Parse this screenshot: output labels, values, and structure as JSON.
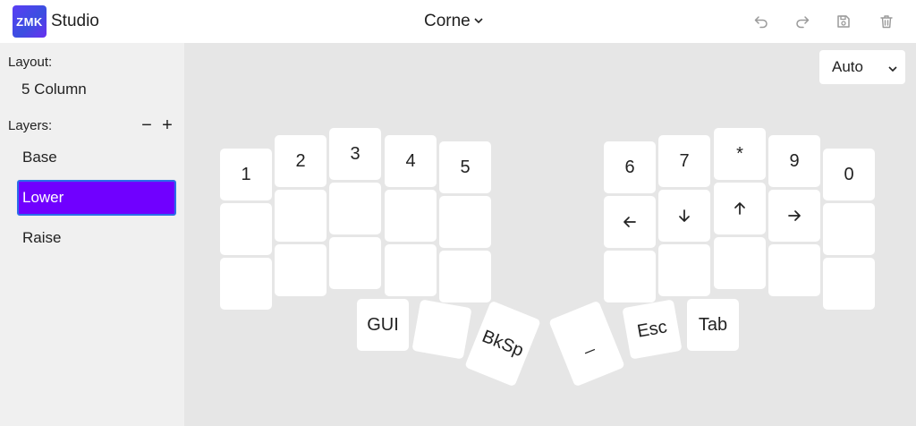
{
  "header": {
    "logo_text": "ZMK",
    "app_name": "Studio",
    "keyboard_name": "Corne"
  },
  "sidebar": {
    "layout_label": "Layout:",
    "layout_name": "5 Column",
    "layers_label": "Layers:",
    "remove_layer_label": "−",
    "add_layer_label": "+",
    "layers": [
      {
        "label": "Base"
      },
      {
        "label": "Lower",
        "selected": true
      },
      {
        "label": "Raise"
      }
    ]
  },
  "canvas": {
    "zoom_value": "Auto"
  },
  "keys": [
    {
      "label": "1"
    },
    {
      "label": "2"
    },
    {
      "label": "3"
    },
    {
      "label": "4"
    },
    {
      "label": "5"
    },
    {
      "label": "6"
    },
    {
      "label": "7"
    },
    {
      "label": "*"
    },
    {
      "label": "9"
    },
    {
      "label": "0"
    },
    {
      "label": ""
    },
    {
      "label": ""
    },
    {
      "label": ""
    },
    {
      "label": ""
    },
    {
      "label": ""
    },
    {
      "icon": "arrow-left-icon"
    },
    {
      "icon": "arrow-down-icon"
    },
    {
      "icon": "arrow-up-icon"
    },
    {
      "icon": "arrow-right-icon"
    },
    {
      "label": ""
    },
    {
      "label": ""
    },
    {
      "label": ""
    },
    {
      "label": ""
    },
    {
      "label": ""
    },
    {
      "label": ""
    },
    {
      "label": ""
    },
    {
      "label": ""
    },
    {
      "label": ""
    },
    {
      "label": ""
    },
    {
      "label": ""
    },
    {
      "label": "GUI"
    },
    {
      "label": ""
    },
    {
      "label": "BkSp"
    },
    {
      "label": "_"
    },
    {
      "label": "Esc"
    },
    {
      "label": "Tab"
    }
  ],
  "colors": {
    "accent": "#7000ff",
    "focus_border": "#2b6fe8",
    "canvas_bg": "#e6e6e6",
    "sidebar_bg": "#f0f0f0"
  }
}
